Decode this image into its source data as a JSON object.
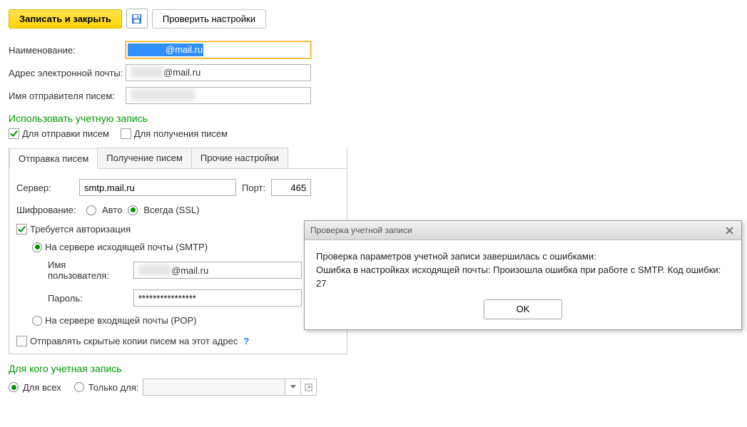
{
  "toolbar": {
    "save_close": "Записать и закрыть",
    "check_settings": "Проверить настройки"
  },
  "fields": {
    "name_label": "Наименование:",
    "name_value_suffix": "@mail.ru",
    "email_label": "Адрес электронной почты:",
    "email_value_suffix": "@mail.ru",
    "sender_label": "Имя отправителя писем:"
  },
  "use_account": {
    "title": "Использовать учетную запись",
    "send": "Для отправки писем",
    "receive": "Для получения писем"
  },
  "tabs": {
    "send": "Отправка писем",
    "receive": "Получение писем",
    "other": "Прочие настройки"
  },
  "smtp": {
    "server_label": "Сервер:",
    "server_value": "smtp.mail.ru",
    "port_label": "Порт:",
    "port_value": "465",
    "encryption_label": "Шифрование:",
    "encryption_auto": "Авто",
    "encryption_ssl": "Всегда (SSL)",
    "auth_required": "Требуется авторизация",
    "auth_smtp": "На сервере исходящей почты (SMTP)",
    "auth_user_label": "Имя пользователя:",
    "auth_user_suffix": "@mail.ru",
    "auth_pass_label": "Пароль:",
    "auth_pass_value": "****************",
    "auth_pop": "На сервере входящей почты (POP)",
    "bcc": "Отправлять скрытые копии писем на этот адрес",
    "help": "?"
  },
  "scope": {
    "title": "Для кого учетная запись",
    "all": "Для всех",
    "only": "Только для:"
  },
  "dialog": {
    "title": "Проверка учетной записи",
    "line1": "Проверка параметров учетной записи завершилась с ошибками:",
    "line2": "Ошибка в настройках исходящей почты: Произошла ошибка при работе с SMTP. Код ошибки: 27",
    "ok": "OK"
  }
}
